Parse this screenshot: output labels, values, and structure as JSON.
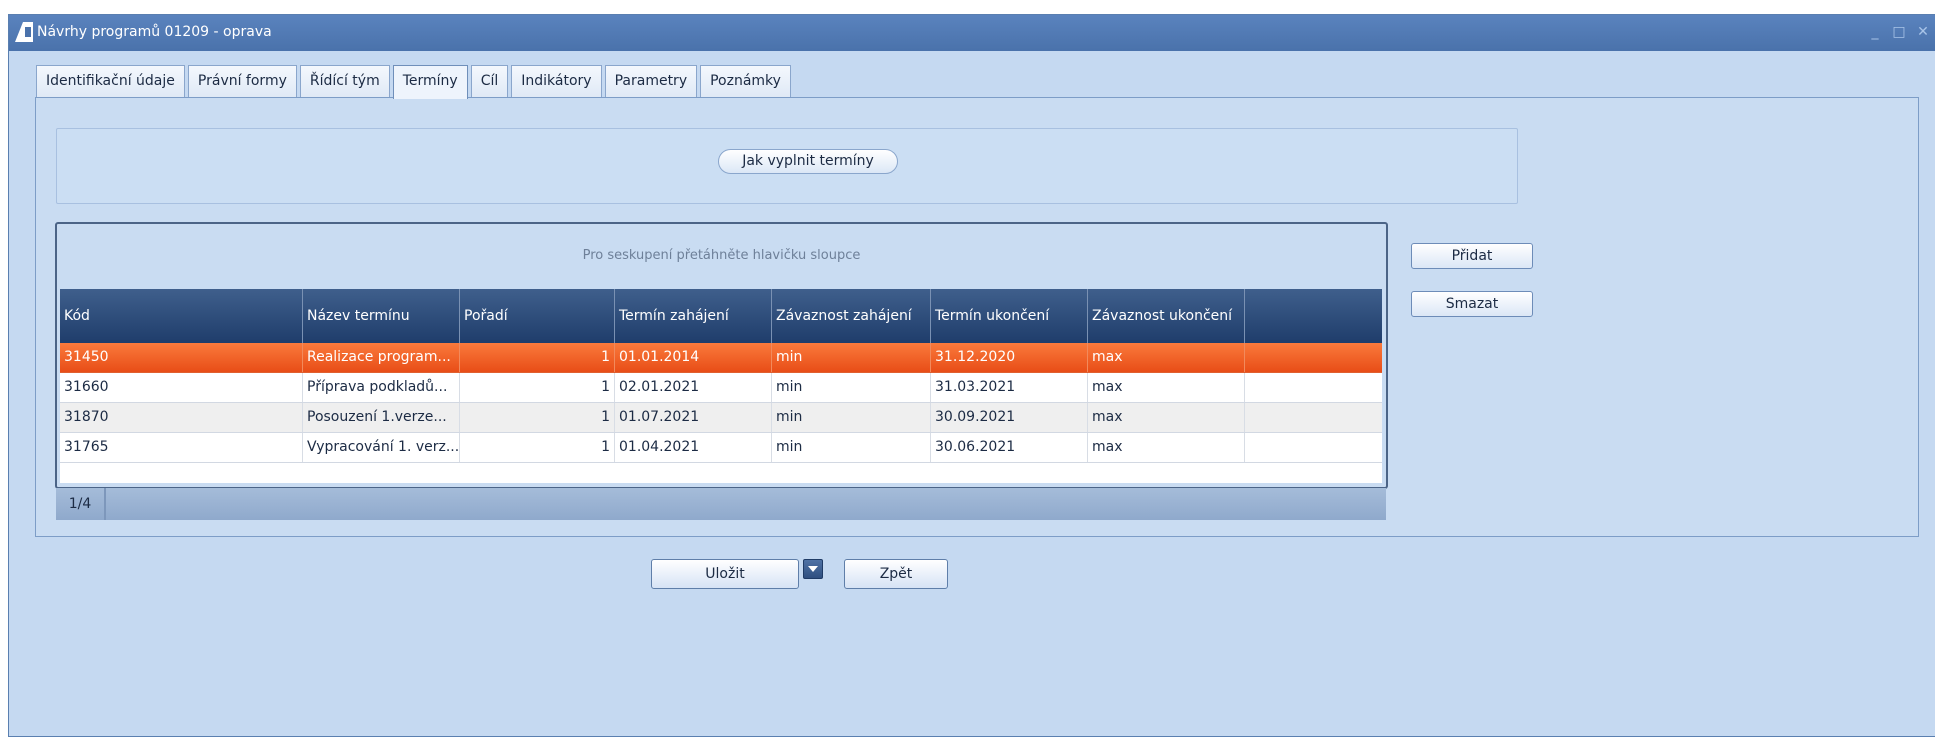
{
  "window": {
    "title": "Návrhy programů 01209 - oprava",
    "controls": [
      "minimize-icon",
      "maximize-icon",
      "close-icon"
    ]
  },
  "tabs": [
    {
      "label": "Identifikační údaje",
      "active": false
    },
    {
      "label": "Právní formy",
      "active": false
    },
    {
      "label": "Řídící tým",
      "active": false
    },
    {
      "label": "Termíny",
      "active": true
    },
    {
      "label": "Cíl",
      "active": false
    },
    {
      "label": "Indikátory",
      "active": false
    },
    {
      "label": "Parametry",
      "active": false
    },
    {
      "label": "Poznámky",
      "active": false
    }
  ],
  "help_button": "Jak vyplnit termíny",
  "grid": {
    "grouping_hint": "Pro seskupení přetáhněte hlavičku sloupce",
    "columns": [
      "Kód",
      "Název termínu",
      "Pořadí",
      "Termín zahájení",
      "Závaznost zahájení",
      "Termín ukončení",
      "Závaznost ukončení",
      ""
    ],
    "rows": [
      {
        "kod": "31450",
        "nazev": "Realizace program...",
        "poradi": "1",
        "zahajeni": "01.01.2014",
        "zav_zah": "min",
        "ukonceni": "31.12.2020",
        "zav_uk": "max",
        "selected": true
      },
      {
        "kod": "31660",
        "nazev": "Příprava podkladů...",
        "poradi": "1",
        "zahajeni": "02.01.2021",
        "zav_zah": "min",
        "ukonceni": "31.03.2021",
        "zav_uk": "max",
        "selected": false
      },
      {
        "kod": "31870",
        "nazev": "Posouzení 1.verze...",
        "poradi": "1",
        "zahajeni": "01.07.2021",
        "zav_zah": "min",
        "ukonceni": "30.09.2021",
        "zav_uk": "max",
        "selected": false
      },
      {
        "kod": "31765",
        "nazev": "Vypracování 1. verz...",
        "poradi": "1",
        "zahajeni": "01.04.2021",
        "zav_zah": "min",
        "ukonceni": "30.06.2021",
        "zav_uk": "max",
        "selected": false
      }
    ],
    "pager": "1/4"
  },
  "side_buttons": {
    "add": "Přidat",
    "delete": "Smazat"
  },
  "bottom_buttons": {
    "save": "Uložit",
    "back": "Zpět"
  },
  "colors": {
    "selected_row": "#f26a2a",
    "header": "#2c4a78",
    "panel": "#c9dcf2"
  }
}
